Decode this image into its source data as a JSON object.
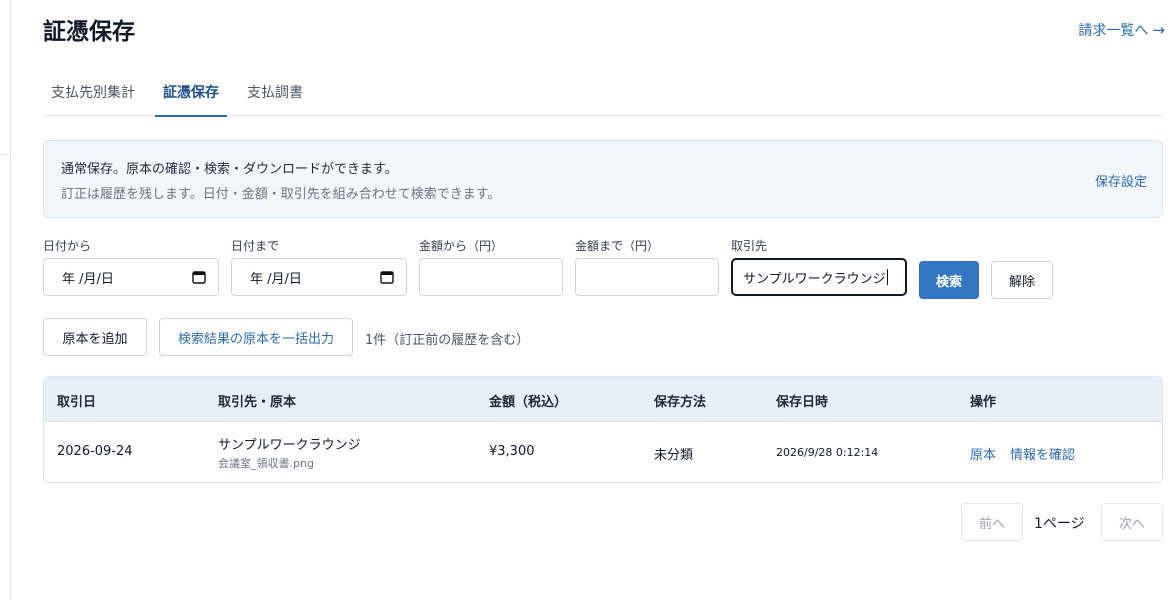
{
  "header": {
    "title": "証憑保存",
    "invoice_link": "請求一覧へ",
    "invoice_link_arrow": "→"
  },
  "tabs": [
    {
      "label": "支払先別集計",
      "active": false
    },
    {
      "label": "証憑保存",
      "active": true
    },
    {
      "label": "支払調書",
      "active": false
    }
  ],
  "info": {
    "line1": "通常保存。原本の確認・検索・ダウンロードができます。",
    "line2": "訂正は履歴を残します。日付・金額・取引先を組み合わせて検索できます。",
    "settings_link": "保存設定"
  },
  "filters": {
    "date_from_label": "日付から",
    "date_from_placeholder": "年 /月/日",
    "date_to_label": "日付まで",
    "date_to_placeholder": "年 /月/日",
    "amount_from_label": "金額から（円）",
    "amount_from_value": "",
    "amount_to_label": "金額まで（円）",
    "amount_to_value": "",
    "vendor_label": "取引先",
    "vendor_value": "サンプルワークラウンジ",
    "search_button": "検索",
    "clear_button": "解除"
  },
  "actions": {
    "add_original": "原本を追加",
    "bulk_export": "検索結果の原本を一括出力",
    "result_count": "1件（訂正前の履歴を含む）"
  },
  "table": {
    "columns": [
      "取引日",
      "取引先・原本",
      "金額（税込）",
      "保存方法",
      "保存日時",
      "操作"
    ],
    "rows": [
      {
        "date": "2026-09-24",
        "vendor": "サンプルワークラウンジ",
        "file": "会議室_領収書.png",
        "amount": "¥3,300",
        "method": "未分類",
        "saved_at": "2026/9/28 0:12:14",
        "op_original": "原本",
        "op_info": "情報を確認"
      }
    ]
  },
  "pagination": {
    "prev": "前へ",
    "current": "1ページ",
    "next": "次へ"
  },
  "colors": {
    "accent": "#3377c2",
    "link": "#2b6cb0",
    "info_bg": "#f3f7fc",
    "table_header_bg": "#e7f0f9"
  }
}
